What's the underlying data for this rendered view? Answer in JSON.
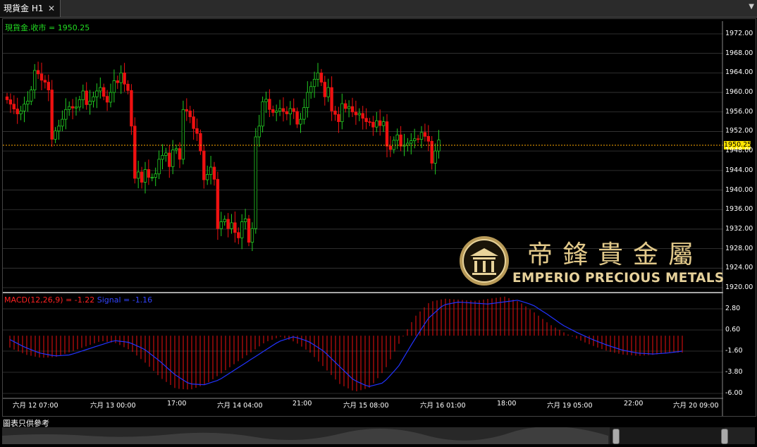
{
  "tab": {
    "title": "現貨金 H1",
    "close": "✕",
    "menu": "▼"
  },
  "legend": {
    "main": "現貨金.收市 = 1950.25"
  },
  "macd_legend": {
    "label": "MACD(12,26,9) = -1.22",
    "signal": "Signal = -1.16"
  },
  "current_price": "1950.25",
  "price_axis": [
    "1972.00",
    "1968.00",
    "1964.00",
    "1960.00",
    "1956.00",
    "1952.00",
    "1948.00",
    "1944.00",
    "1940.00",
    "1936.00",
    "1932.00",
    "1928.00",
    "1924.00",
    "1920.00"
  ],
  "macd_axis": [
    "2.80",
    "0.60",
    "-1.60",
    "-3.80",
    "-6.00"
  ],
  "time_axis": [
    "六月 12 07:00",
    "六月 13 00:00",
    "17:00",
    "六月 14 04:00",
    "21:00",
    "六月 15 08:00",
    "六月 16 01:00",
    "18:00",
    "六月 19 05:00",
    "22:00",
    "六月 20 09:00"
  ],
  "footer": {
    "disclaimer": "圖表只供參考"
  },
  "logo": {
    "chinese": "帝鋒貴金屬",
    "english": "EMPERIO PRECIOUS METALS"
  },
  "colors": {
    "up": "#22cc22",
    "down": "#ee1111",
    "signal": "#2233ff",
    "price_line": "#ffaa00",
    "accent": "#ffe600",
    "gold": "#e2c98a"
  },
  "chart_data": {
    "type": "candlestick",
    "symbol": "現貨金",
    "timeframe": "H1",
    "price_ylim": [
      1920,
      1974
    ],
    "last_close": 1950.25,
    "close_path": [
      1958.5,
      1957.6,
      1956.6,
      1955.6,
      1956.2,
      1957.6,
      1958.2,
      1960.5,
      1964.5,
      1963.8,
      1962.5,
      1962.1,
      1960.5,
      1950.4,
      1952.1,
      1953.1,
      1954.5,
      1956.5,
      1957.1,
      1956.8,
      1957.0,
      1958.5,
      1960.3,
      1957.5,
      1958.2,
      1959.1,
      1960.3,
      1961.0,
      1959.2,
      1958.0,
      1960.0,
      1962.4,
      1962.0,
      1964.0,
      1961.7,
      1960.4,
      1953.1,
      1942.4,
      1943.7,
      1941.6,
      1944.2,
      1942.6,
      1942.6,
      1943.3,
      1946.3,
      1947.1,
      1947.6,
      1944.8,
      1948.2,
      1948.5,
      1946.3,
      1956.5,
      1956.2,
      1955.0,
      1952.6,
      1951.6,
      1948.0,
      1942.1,
      1943.2,
      1944.7,
      1942.2,
      1932.1,
      1933.5,
      1934.0,
      1932.1,
      1933.3,
      1931.3,
      1930.2,
      1933.5,
      1934.1,
      1929.3,
      1932.1,
      1950.9,
      1953.1,
      1958.1,
      1958.6,
      1956.5,
      1955.9,
      1956.2,
      1956.7,
      1956.1,
      1955.6,
      1956.7,
      1956.1,
      1953.5,
      1954.5,
      1956.9,
      1960.0,
      1961.2,
      1962.7,
      1964.0,
      1962.1,
      1959.1,
      1961.0,
      1956.2,
      1955.5,
      1954.0,
      1957.7,
      1956.7,
      1957.1,
      1956.0,
      1955.4,
      1955.7,
      1954.7,
      1954.0,
      1953.9,
      1952.9,
      1954.2,
      1953.2,
      1954.0,
      1949.0,
      1948.3,
      1950.2,
      1951.3,
      1949.0,
      1949.2,
      1949.6,
      1950.1,
      1950.5,
      1950.4,
      1951.8,
      1951.0,
      1950.0,
      1945.5,
      1948.0,
      1950.25
    ],
    "macd_ylim": [
      -6.0,
      4.0
    ],
    "macd_signal_path": [
      -0.4,
      -1.2,
      -1.8,
      -2.1,
      -2.0,
      -1.5,
      -1.0,
      -0.5,
      -0.7,
      -1.4,
      -2.6,
      -4.0,
      -5.0,
      -5.1,
      -4.6,
      -3.6,
      -2.6,
      -1.6,
      -0.6,
      -0.1,
      -0.6,
      -1.6,
      -3.1,
      -4.6,
      -5.3,
      -4.9,
      -3.2,
      -0.6,
      1.8,
      3.2,
      3.5,
      3.4,
      3.3,
      3.5,
      3.7,
      3.2,
      2.2,
      1.1,
      0.3,
      -0.4,
      -1.0,
      -1.5,
      -1.8,
      -1.9,
      -1.8,
      -1.6
    ]
  }
}
